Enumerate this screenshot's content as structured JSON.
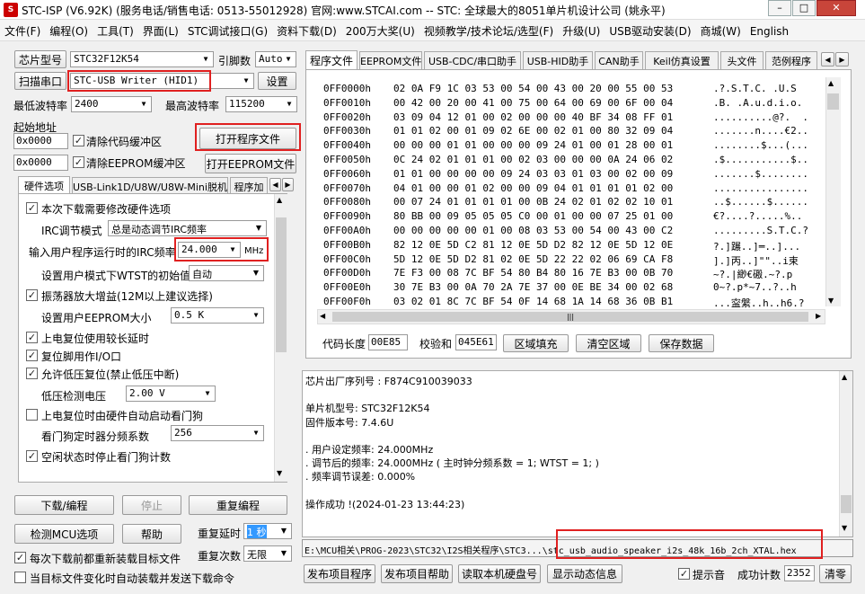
{
  "window": {
    "title": "STC-ISP (V6.92K) (服务电话/销售电话: 0513-55012928) 官网:www.STCAI.com  -- STC: 全球最大的8051单片机设计公司 (姚永平)",
    "min": "–",
    "max": "□",
    "close": "✕"
  },
  "menu": [
    "文件(F)",
    "编程(O)",
    "工具(T)",
    "界面(L)",
    "STC调试接口(G)",
    "资料下载(D)",
    "200万大奖(U)",
    "视频教学/技术论坛/选型(F)",
    "升级(U)",
    "USB驱动安装(D)",
    "商城(W)",
    "English"
  ],
  "left": {
    "chip_btn": "芯片型号",
    "chip_val": "STC32F12K54",
    "pin_lbl": "引脚数",
    "pin_val": "Auto",
    "scan_btn": "扫描串口",
    "port_val": "STC-USB Writer (HID1)",
    "settings_btn": "设置",
    "min_baud_lbl": "最低波特率",
    "min_baud": "2400",
    "max_baud_lbl": "最高波特率",
    "max_baud": "115200",
    "start_addr_lbl": "起始地址",
    "code_addr": "0x0000",
    "clear_code": "清除代码缓冲区",
    "open_prog": "打开程序文件",
    "eep_addr": "0x0000",
    "clear_eep": "清除EEPROM缓冲区",
    "open_eep": "打开EEPROM文件",
    "tabs": [
      "硬件选项",
      "USB-Link1D/U8W/U8W-Mini脱机",
      "程序加"
    ],
    "hw": {
      "modify": "本次下载需要修改硬件选项",
      "irc_mode_lbl": "IRC调节模式",
      "irc_mode": "总是动态调节IRC频率",
      "freq_lbl": "输入用户程序运行时的IRC频率",
      "freq": "24.000",
      "mhz": "MHz",
      "wtst_lbl": "设置用户模式下WTST的初始值",
      "wtst": "自动",
      "osc": "振荡器放大增益(12M以上建议选择)",
      "eep_size_lbl": "设置用户EEPROM大小",
      "eep_size": "0.5 K",
      "long_delay": "上电复位使用较长延时",
      "reset_io": "复位脚用作I/O口",
      "lvd": "允许低压复位(禁止低压中断)",
      "lvd_lbl": "低压检测电压",
      "lvd_val": "2.00 V",
      "wdt": "上电复位时由硬件自动启动看门狗",
      "wdt_lbl": "看门狗定时器分频系数",
      "wdt_val": "256",
      "idle_wdt": "空闲状态时停止看门狗计数"
    },
    "download_btn": "下载/编程",
    "stop_btn": "停止",
    "repeat_btn": "重复编程",
    "detect_btn": "检测MCU选项",
    "help_btn": "帮助",
    "repeat_delay_lbl": "重复延时",
    "repeat_delay": "1 秒",
    "repeat_count_lbl": "重复次数",
    "repeat_count": "无限",
    "reload_each": "每次下载前都重新装载目标文件",
    "auto_send": "当目标文件变化时自动装载并发送下载命令"
  },
  "right": {
    "tabs": [
      "程序文件",
      "EEPROM文件",
      "USB-CDC/串口助手",
      "USB-HID助手",
      "CAN助手",
      "Keil仿真设置",
      "头文件",
      "范例程序"
    ],
    "hex": [
      {
        "addr": "0FF0000h",
        "bytes": "02 0A F9 1C 03 53 00 54 00 43 00 20 00 55 00 53",
        "ascii": ".?.S.T.C. .U.S"
      },
      {
        "addr": "0FF0010h",
        "bytes": "00 42 00 20 00 41 00 75 00 64 00 69 00 6F 00 04",
        "ascii": ".B. .A.u.d.i.o."
      },
      {
        "addr": "0FF0020h",
        "bytes": "03 09 04 12 01 00 02 00 00 00 40 BF 34 08 FF 01",
        "ascii": "..........@?.  ."
      },
      {
        "addr": "0FF0030h",
        "bytes": "01 01 02 00 01 09 02 6E 00 02 01 00 80 32 09 04",
        "ascii": ".......n....€2.."
      },
      {
        "addr": "0FF0040h",
        "bytes": "00 00 00 01 01 00 00 00 09 24 01 00 01 28 00 01",
        "ascii": "........$...(..."
      },
      {
        "addr": "0FF0050h",
        "bytes": "0C 24 02 01 01 01 00 02 03 00 00 00 0A 24 06 02",
        "ascii": ".$...........$.."
      },
      {
        "addr": "0FF0060h",
        "bytes": "01 01 00 00 00 00 09 24 03 03 01 03 00 02 00 09",
        "ascii": ".......$........"
      },
      {
        "addr": "0FF0070h",
        "bytes": "04 01 00 00 01 02 00 00 09 04 01 01 01 01 02 00",
        "ascii": "................"
      },
      {
        "addr": "0FF0080h",
        "bytes": "00 07 24 01 01 01 01 00 0B 24 02 01 02 02 10 01",
        "ascii": "..$......$......"
      },
      {
        "addr": "0FF0090h",
        "bytes": "80 BB 00 09 05 05 05 C0 00 01 00 00 07 25 01 00",
        "ascii": "€?....?.....%.."
      },
      {
        "addr": "0FF00A0h",
        "bytes": "00 00 00 00 00 01 00 08 03 53 00 54 00 43 00 C2",
        "ascii": ".........S.T.C.?"
      },
      {
        "addr": "0FF00B0h",
        "bytes": "82 12 0E 5D C2 81 12 0E 5D D2 82 12 0E 5D 12 0E",
        "ascii": "?.]蹍..]═..]..."
      },
      {
        "addr": "0FF00C0h",
        "bytes": "5D 12 0E 5D D2 81 02 0E 5D 22 22 02 06 69 CA F8",
        "ascii": "].]丙..]\"\"..i束"
      },
      {
        "addr": "0FF00D0h",
        "bytes": "7E F3 00 08 7C BF 54 80 B4 80 16 7E B3 00 0B 70",
        "ascii": "~?.|緲€磤.~?.p"
      },
      {
        "addr": "0FF00E0h",
        "bytes": "30 7E B3 00 0A 70 2A 7E 37 00 0E BE 34 00 02 68",
        "ascii": "0~?.p*~7..?..h"
      },
      {
        "addr": "0FF00F0h",
        "bytes": "03 02 01 8C 7C BF 54 0F 14 68 1A 14 68 36 0B B1",
        "ascii": "...寍縏..h..h6.?"
      }
    ],
    "code_len_lbl": "代码长度",
    "code_len": "00E85",
    "checksum_lbl": "校验和",
    "checksum": "045E61",
    "fill_btn": "区域填充",
    "clear_btn": "清空区域",
    "save_btn": "保存数据",
    "log": [
      "芯片出厂序列号 : F874C910039033",
      "",
      "  单片机型号: STC32F12K54",
      "  固件版本号: 7.4.6U",
      "",
      "  . 用户设定频率: 24.000MHz",
      "  . 调节后的频率: 24.000MHz ( 主时钟分频系数 = 1;  WTST = 1; )",
      "  . 频率调节误差: 0.000%",
      "",
      "操作成功 !(2024-01-23 13:44:23)"
    ],
    "path_prefix": "E:\\MCU相关\\PROG-2023\\STC32\\I2S相关程序\\STC3...",
    "path_file": "\\stc_usb_audio_speaker_i2s_48k_16b_2ch_XTAL.hex",
    "publish_prog": "发布项目程序",
    "publish_help": "发布项目帮助",
    "read_disk": "读取本机硬盘号",
    "show_anim": "显示动态信息",
    "beep": "提示音",
    "success_lbl": "成功计数",
    "success_count": "2352",
    "clear": "清零"
  },
  "colors": {
    "highlight": "#e02020",
    "selection": "#3399ff"
  }
}
